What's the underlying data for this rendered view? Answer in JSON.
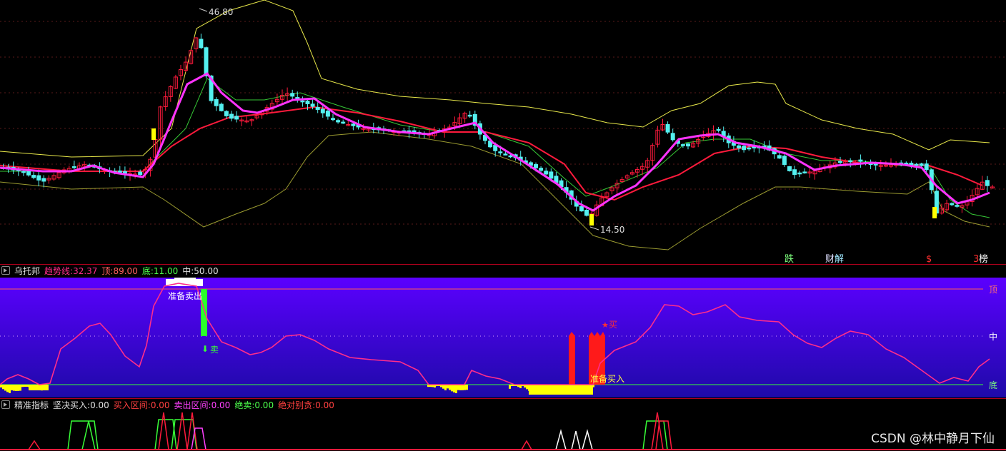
{
  "main_chart": {
    "high_label": "46.80",
    "low_label": "14.50",
    "event_markers": [
      {
        "text": "跌",
        "color": "#7dff7d"
      },
      {
        "text": "财",
        "color": "#e0e0ff"
      },
      {
        "text": "解",
        "color": "#a0e8ff"
      },
      {
        "text": "$",
        "color": "#ff3030"
      },
      {
        "text": "3",
        "color": "#ff3030"
      },
      {
        "text": "榜",
        "color": "#ffffff"
      }
    ],
    "colors": {
      "up": "#ff1a3c",
      "down": "#54f0f0",
      "ma_fast": "#ff33ff",
      "ma_slow": "#ff1a3c",
      "band": "#e8e84a",
      "band_low": "#9a9a30"
    }
  },
  "indicator1": {
    "name": "乌托邦",
    "trend_label": "趋势线:",
    "trend_value": "32.37",
    "top_label": "顶:",
    "top_value": "89.00",
    "bottom_label": "底:",
    "bottom_value": "11.00",
    "mid_label": "中:",
    "mid_value": "50.00",
    "right_top": "顶",
    "right_mid": "中",
    "right_bottom": "底",
    "annotations": {
      "prepare_sell": "准备卖出",
      "sell": "卖",
      "buy": "买",
      "prepare_buy": "准备买入"
    },
    "colors": {
      "trend": "#ff2d8a",
      "bg_top": "#5b00ff",
      "bg_bottom": "#1e0aa8"
    }
  },
  "indicator2": {
    "name": "精准指标",
    "firm_buy_label": "坚决买入:",
    "firm_buy_value": "0.00",
    "buy_zone_label": "买入区间:",
    "buy_zone_value": "0.00",
    "sell_zone_label": "卖出区间:",
    "sell_zone_value": "0.00",
    "must_sell_label": "绝卖:",
    "must_sell_value": "0.00",
    "no_greed_label": "绝对别贪:",
    "no_greed_value": "0.00"
  },
  "watermark": "CSDN @林中静月下仙"
}
